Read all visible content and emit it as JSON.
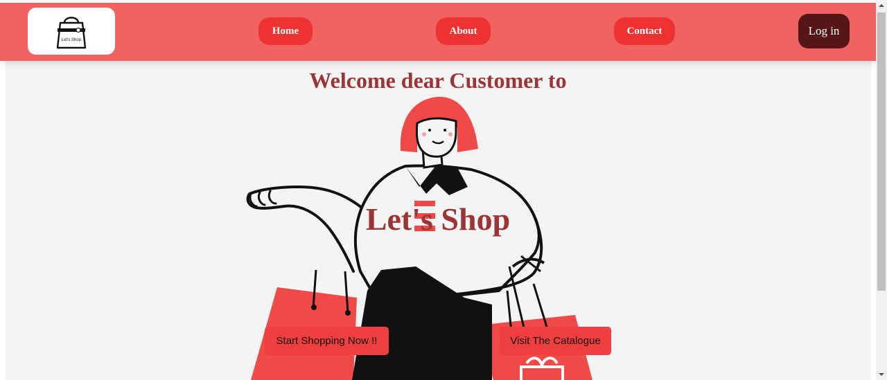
{
  "header": {
    "logo_alt": "Let's Shop",
    "logo_text": "Let's Shop",
    "nav": {
      "home": "Home",
      "about": "About",
      "contact": "Contact"
    },
    "login_label": "Log in"
  },
  "hero": {
    "welcome": "Welcome dear Customer to",
    "brand": "Let's Shop",
    "cta_shop": "Start Shopping Now !!",
    "cta_catalogue": "Visit The Catalogue"
  },
  "colors": {
    "navbar": "#f16363",
    "nav_button": "#ee3232",
    "login_button": "#541616",
    "heading": "#9b3535",
    "cta": "#ee3e3e",
    "background": "#f5f4f4"
  },
  "icons": {
    "logo": "shopping-bag-icon",
    "scroll_up": "chevron-up-icon",
    "scroll_down": "chevron-down-icon"
  }
}
